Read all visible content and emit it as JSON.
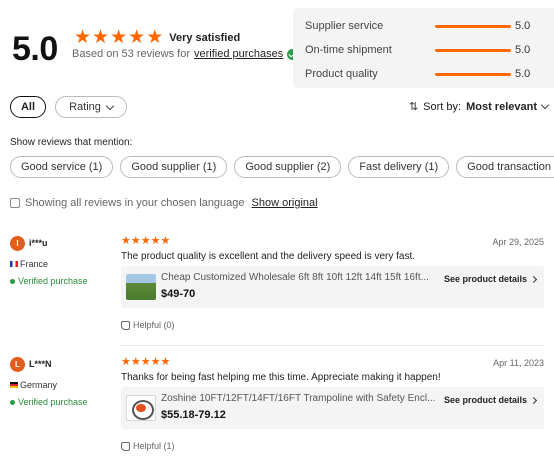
{
  "summary": {
    "score": "5.0",
    "stars": 5,
    "satisfaction": "Very satisfied",
    "based_prefix": "Based on 53 reviews for",
    "based_link": "verified purchases"
  },
  "metrics": [
    {
      "label": "Supplier service",
      "value": "5.0"
    },
    {
      "label": "On-time shipment",
      "value": "5.0"
    },
    {
      "label": "Product quality",
      "value": "5.0"
    }
  ],
  "filters": {
    "all_label": "All",
    "rating_label": "Rating",
    "sort_prefix": "Sort by:",
    "sort_value": "Most relevant"
  },
  "mentions": {
    "title": "Show reviews that mention:",
    "chips": [
      "Good service (1)",
      "Good supplier (1)",
      "Good supplier (2)",
      "Fast delivery (1)",
      "Good transaction (2)"
    ]
  },
  "language": {
    "text": "Showing all reviews in your chosen language",
    "link": "Show original"
  },
  "reviews": [
    {
      "initial": "I",
      "user": "i***u",
      "country": "France",
      "verified": "Verified purchase",
      "stars": 5,
      "date": "Apr 29, 2025",
      "text": "The product quality is excellent and the delivery speed is very fast.",
      "product_name": "Cheap Customized Wholesale 6ft 8ft 10ft 12ft 14ft 15ft 16ft...",
      "product_price": "$49-70",
      "details_label": "See product details",
      "helpful": "Helpful (0)"
    },
    {
      "initial": "L",
      "user": "L***N",
      "country": "Germany",
      "verified": "Verified purchase",
      "stars": 5,
      "date": "Apr 11, 2023",
      "text": "Thanks for being fast helping me this time. Appreciate making it happen!",
      "product_name": "Zoshine 10FT/12FT/14FT/16FT Trampoline with Safety Encl...",
      "product_price": "$55.18-79.12",
      "details_label": "See product details",
      "helpful": "Helpful (1)"
    }
  ],
  "colors": {
    "accent": "#ff6600",
    "verified": "#2a8a3a",
    "panel": "#f4f4f4"
  }
}
